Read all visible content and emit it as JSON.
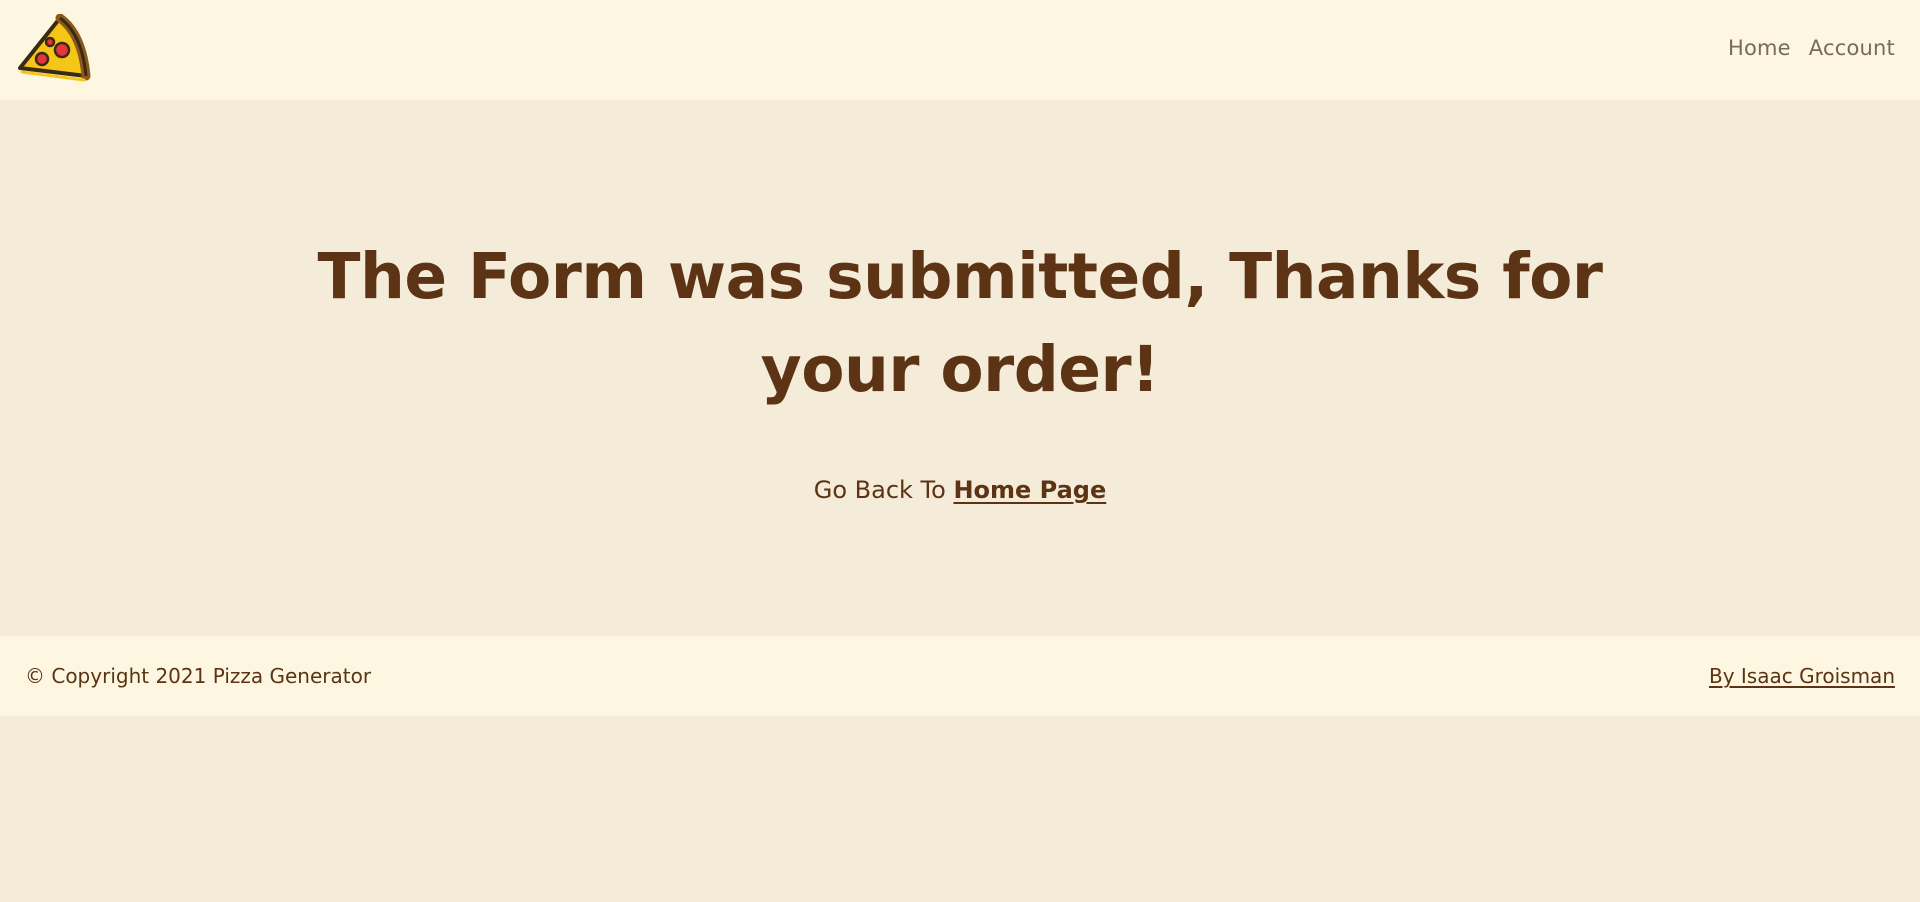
{
  "nav": {
    "logo_icon": "pizza-slice-icon",
    "links": [
      "Home",
      "Account"
    ]
  },
  "main": {
    "headline": "The Form was submitted, Thanks for your order!",
    "go_back_prefix": "Go Back To",
    "home_link": "Home Page"
  },
  "footer": {
    "copyright": "© Copyright 2021 Pizza Generator",
    "author": "By Isaac Groisman"
  },
  "colors": {
    "nav_bg": "#fdf7e1",
    "page_bg": "#f4ecd8",
    "text_brown": "#5c3314",
    "nav_text": "#7a6a58"
  }
}
